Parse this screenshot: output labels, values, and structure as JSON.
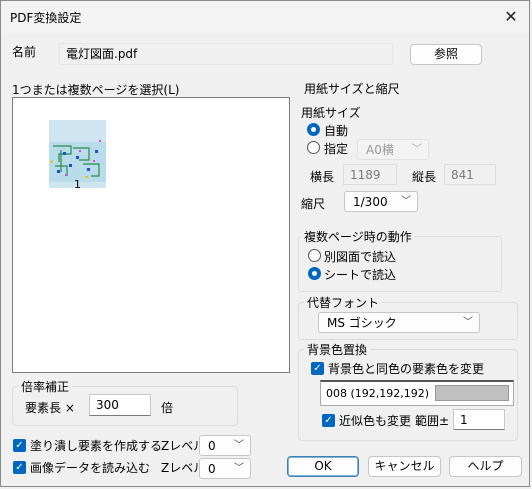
{
  "window": {
    "title": "PDF変換設定",
    "close_glyph": "✕"
  },
  "name_row": {
    "label": "名前",
    "value": "電灯図面.pdf",
    "browse_button": "参照"
  },
  "page_list": {
    "label": "1つまたは複数ページを選択(L)",
    "pages": [
      {
        "number": "1"
      }
    ]
  },
  "paper": {
    "group_label": "用紙サイズと縮尺",
    "size_label": "用紙サイズ",
    "auto_label": "自動",
    "specify_label": "指定",
    "preset_value": "A0横",
    "width_label": "横長",
    "width_value": "1189",
    "height_label": "縦長",
    "height_value": "841",
    "scale_label": "縮尺",
    "scale_value": "1/300"
  },
  "multipage": {
    "group_label": "複数ページ時の動作",
    "option_separate": "別図面で読込",
    "option_sheet": "シートで読込"
  },
  "font": {
    "group_label": "代替フォント",
    "value": "MS ゴシック"
  },
  "bgcolor": {
    "group_label": "背景色置換",
    "check_label": "背景色と同色の要素色を変更",
    "color_text": "008 (192,192,192)",
    "swatch_color": "#c0c0c0",
    "similar_label": "近似色も変更",
    "range_label": "範囲±",
    "range_value": "1"
  },
  "magnification": {
    "group_label": "倍率補正",
    "element_label": "要素長 ×",
    "value": "300",
    "unit": "倍"
  },
  "options": {
    "fill_label": "塗り潰し要素を作成する",
    "image_label": "画像データを読み込む",
    "z_label": "Zレベル",
    "z_fill_value": "0",
    "z_image_value": "0"
  },
  "buttons": {
    "ok": "OK",
    "cancel": "キャンセル",
    "help": "ヘルプ"
  },
  "colors": {
    "accent": "#0067c0"
  }
}
